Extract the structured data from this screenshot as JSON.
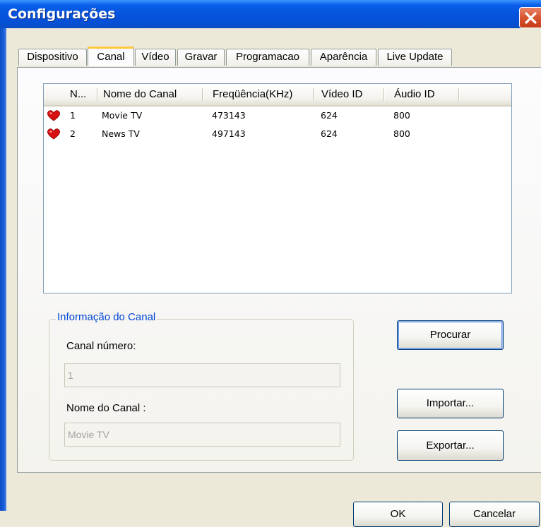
{
  "window": {
    "title": "Configurações",
    "close_icon": "close-icon"
  },
  "tabs": [
    {
      "label": "Dispositivo",
      "active": false
    },
    {
      "label": "Canal",
      "active": true
    },
    {
      "label": "Vídeo",
      "active": false
    },
    {
      "label": "Gravar",
      "active": false
    },
    {
      "label": "Programacao",
      "active": false
    },
    {
      "label": "Aparência",
      "active": false
    },
    {
      "label": "Live Update",
      "active": false
    }
  ],
  "channel_list": {
    "columns": [
      "N...",
      "Nome do Canal",
      "Freqüência(KHz)",
      "Vídeo ID",
      "Áudio ID"
    ],
    "rows": [
      {
        "number": "1",
        "name": "Movie TV",
        "frequency": "473143",
        "video_id": "624",
        "audio_id": "800",
        "icon": "heart-icon"
      },
      {
        "number": "2",
        "name": "News TV",
        "frequency": "497143",
        "video_id": "624",
        "audio_id": "800",
        "icon": "heart-icon"
      }
    ]
  },
  "channel_info": {
    "group_title": "Informação do Canal",
    "number_label": "Canal número:",
    "number_value": "1",
    "name_label": "Nome do Canal :",
    "name_value": "Movie TV"
  },
  "buttons": {
    "search": "Procurar",
    "import": "Importar...",
    "export": "Exportar...",
    "ok": "OK",
    "cancel": "Cancelar"
  },
  "colors": {
    "title_bar": "#0653dc",
    "active_tab_highlight": "#ffc83c",
    "group_title": "#0046d5",
    "heart": "#d81010"
  }
}
